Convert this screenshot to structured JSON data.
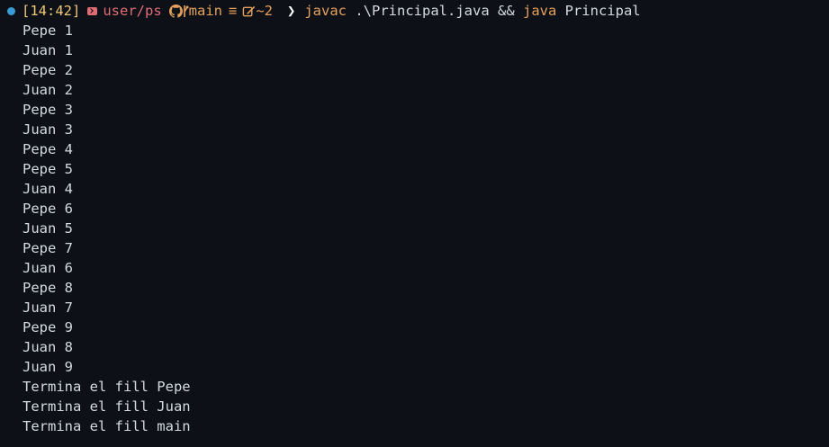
{
  "prompt": {
    "time": "[14:42]",
    "user_path": "user/ps",
    "branch": "main",
    "sync_symbol": "≡",
    "changes": "~2",
    "chevron": "❯",
    "cmd1": "javac",
    "arg1": " .\\Principal.java && ",
    "cmd2": "java",
    "arg2": " Principal",
    "icons": [
      "status-dot-icon",
      "powershell-icon",
      "github-icon",
      "edit-icon"
    ],
    "colors": {
      "time": "#f0c674",
      "user": "#e06c75",
      "branch": "#e5a15b",
      "dot": "#3b9bd6"
    }
  },
  "output_lines": [
    "Pepe 1",
    "Juan 1",
    "Pepe 2",
    "Juan 2",
    "Pepe 3",
    "Juan 3",
    "Pepe 4",
    "Pepe 5",
    "Juan 4",
    "Pepe 6",
    "Juan 5",
    "Pepe 7",
    "Juan 6",
    "Pepe 8",
    "Juan 7",
    "Pepe 9",
    "Juan 8",
    "Juan 9",
    "Termina el fill Pepe",
    "Termina el fill Juan",
    "Termina el fill main"
  ]
}
